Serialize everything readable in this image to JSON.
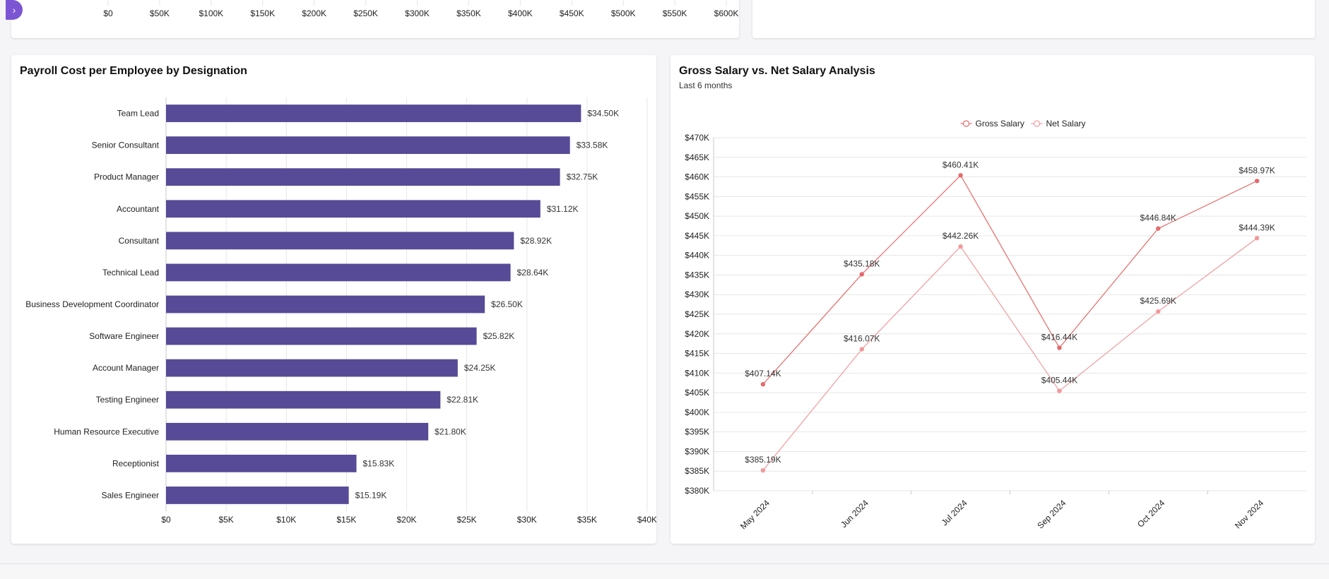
{
  "top_axis": {
    "ticks": [
      "$0",
      "$50K",
      "$100K",
      "$150K",
      "$200K",
      "$250K",
      "$300K",
      "$350K",
      "$400K",
      "$450K",
      "$500K",
      "$550K",
      "$600K"
    ]
  },
  "colors": {
    "bar": "#574a96",
    "gross": "#e46a6a",
    "net": "#f2999b",
    "grid": "#e6e6e6",
    "toggle": "#7b55d4"
  },
  "chart_data": [
    {
      "type": "bar",
      "orientation": "horizontal",
      "title": "Payroll Cost per Employee by Designation",
      "categories": [
        "Team Lead",
        "Senior Consultant",
        "Product Manager",
        "Accountant",
        "Consultant",
        "Technical Lead",
        "Business Development Coordinator",
        "Software Engineer",
        "Account Manager",
        "Testing Engineer",
        "Human Resource Executive",
        "Receptionist",
        "Sales Engineer"
      ],
      "values": [
        34.5,
        33.58,
        32.75,
        31.12,
        28.92,
        28.64,
        26.5,
        25.82,
        24.25,
        22.81,
        21.8,
        15.83,
        15.19
      ],
      "data_labels": [
        "$34.50K",
        "$33.58K",
        "$32.75K",
        "$31.12K",
        "$28.92K",
        "$28.64K",
        "$26.50K",
        "$25.82K",
        "$24.25K",
        "$22.81K",
        "$21.80K",
        "$15.83K",
        "$15.19K"
      ],
      "xlim": [
        0,
        40
      ],
      "x_ticks": [
        0,
        5,
        10,
        15,
        20,
        25,
        30,
        35,
        40
      ],
      "x_tick_labels": [
        "$0",
        "$5K",
        "$10K",
        "$15K",
        "$20K",
        "$25K",
        "$30K",
        "$35K",
        "$40K"
      ],
      "grid": true
    },
    {
      "type": "line",
      "title": "Gross Salary vs. Net Salary Analysis",
      "subtitle": "Last 6 months",
      "categories": [
        "May 2024",
        "Jun 2024",
        "Jul 2024",
        "Sep 2024",
        "Oct 2024",
        "Nov 2024"
      ],
      "series": [
        {
          "name": "Gross Salary",
          "values": [
            407.14,
            435.18,
            460.41,
            416.44,
            446.84,
            458.97
          ],
          "labels": [
            "$407.14K",
            "$435.18K",
            "$460.41K",
            "$416.44K",
            "$446.84K",
            "$458.97K"
          ]
        },
        {
          "name": "Net Salary",
          "values": [
            385.19,
            416.07,
            442.26,
            405.44,
            425.69,
            444.39
          ],
          "labels": [
            "$385.19K",
            "$416.07K",
            "$442.26K",
            "$405.44K",
            "$425.69K",
            "$444.39K"
          ]
        }
      ],
      "ylim": [
        380,
        470
      ],
      "y_ticks": [
        380,
        385,
        390,
        395,
        400,
        405,
        410,
        415,
        420,
        425,
        430,
        435,
        440,
        445,
        450,
        455,
        460,
        465,
        470
      ],
      "y_tick_labels": [
        "$380K",
        "$385K",
        "$390K",
        "$395K",
        "$400K",
        "$405K",
        "$410K",
        "$415K",
        "$420K",
        "$425K",
        "$430K",
        "$435K",
        "$440K",
        "$445K",
        "$450K",
        "$455K",
        "$460K",
        "$465K",
        "$470K"
      ],
      "legend": "top-center",
      "grid": true
    }
  ]
}
